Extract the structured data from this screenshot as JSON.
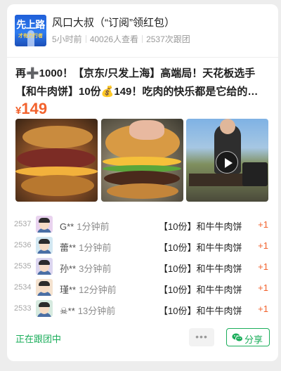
{
  "header": {
    "avatar_line1": "先上路",
    "avatar_line2": "才有力行者",
    "title": "风口大叔（“订阅”领红包）",
    "time_ago": "5小时前",
    "views": "40026人查看",
    "joined": "2537次跟团"
  },
  "post": {
    "title_line1": "再➕1000！【京东/只发上海】高端局！天花板选手",
    "title_line2": "【和牛肉饼】10份💰149！吃肉的快乐都是它给的…",
    "price_currency": "¥",
    "price_value": "149"
  },
  "media": [
    {
      "type": "image",
      "name": "burger-photo-1"
    },
    {
      "type": "image",
      "name": "burger-photo-2"
    },
    {
      "type": "video",
      "name": "video-thumbnail"
    }
  ],
  "records": [
    {
      "index": "2537",
      "user": "G**",
      "time": "1分钟前",
      "product": "【10份】和牛牛肉饼",
      "qty": "+1",
      "avatar_color": "#e9d3ef"
    },
    {
      "index": "2536",
      "user": "蕾**",
      "time": "1分钟前",
      "product": "【10份】和牛牛肉饼",
      "qty": "+1",
      "avatar_color": "#d3e8f2"
    },
    {
      "index": "2535",
      "user": "孙**",
      "time": "3分钟前",
      "product": "【10份】和牛牛肉饼",
      "qty": "+1",
      "avatar_color": "#dcd6f0"
    },
    {
      "index": "2534",
      "user": "瑾**",
      "time": "12分钟前",
      "product": "【10份】和牛牛肉饼",
      "qty": "+1",
      "avatar_color": "#f4e2cf"
    },
    {
      "index": "2533",
      "user": "☠**",
      "time": "13分钟前",
      "product": "【10份】和牛牛肉饼",
      "qty": "+1",
      "avatar_color": "#d6eadf"
    }
  ],
  "footer": {
    "status": "正在跟团中",
    "more_label": "•••",
    "share_label": "分享"
  },
  "colors": {
    "accent_green": "#1aad5a",
    "price_orange": "#f2622d"
  }
}
